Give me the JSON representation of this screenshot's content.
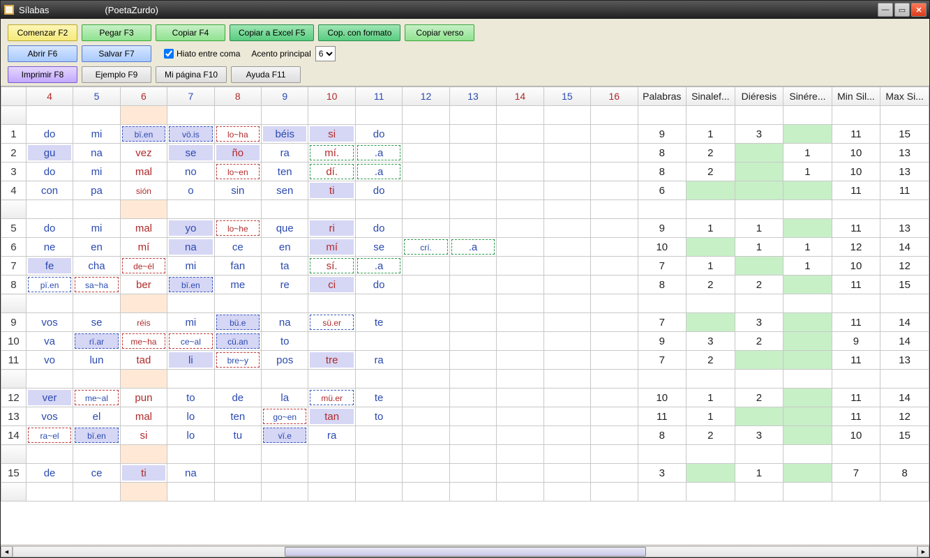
{
  "window": {
    "title": "Sílabas",
    "subtitle": "(PoetaZurdo)"
  },
  "toolbar": {
    "row1": [
      {
        "id": "comenzar",
        "label": "Comenzar F2",
        "cls": "yellow"
      },
      {
        "id": "pegar",
        "label": "Pegar F3",
        "cls": "green"
      },
      {
        "id": "copiar",
        "label": "Copiar F4",
        "cls": "green"
      },
      {
        "id": "copiar-excel",
        "label": "Copiar a Excel F5",
        "cls": "green2"
      },
      {
        "id": "cop-formato",
        "label": "Cop. con formato",
        "cls": "green2"
      },
      {
        "id": "copiar-verso",
        "label": "Copiar verso",
        "cls": "green"
      }
    ],
    "row2": [
      {
        "id": "abrir",
        "label": "Abrir F6",
        "cls": "blue"
      },
      {
        "id": "salvar",
        "label": "Salvar F7",
        "cls": "blue"
      }
    ],
    "row3": [
      {
        "id": "imprimir",
        "label": "Imprimir F8",
        "cls": "purple"
      },
      {
        "id": "ejemplo",
        "label": "Ejemplo F9",
        "cls": "grey"
      },
      {
        "id": "mipagina",
        "label": "Mi página F10",
        "cls": "grey"
      },
      {
        "id": "ayuda",
        "label": "Ayuda F11",
        "cls": "grey"
      }
    ],
    "hiato_label": "Hiato entre coma",
    "hiato_checked": true,
    "acento_label": "Acento principal",
    "acento_value": "6"
  },
  "columns_num": [
    "4",
    "5",
    "6",
    "7",
    "8",
    "9",
    "10",
    "11",
    "12",
    "13",
    "14",
    "15",
    "16"
  ],
  "columns_stat": [
    "Palabras",
    "Sinalef...",
    "Diéresis",
    "Sinére...",
    "Min Sil...",
    "Max Si..."
  ],
  "accent_col_index": 2,
  "rows": [
    {
      "n": "",
      "blank": true
    },
    {
      "n": "1",
      "cells": [
        {
          "t": "do",
          "c": "blue"
        },
        {
          "t": "mi",
          "c": "blue"
        },
        {
          "t": "bï.en",
          "c": "blue",
          "small": true,
          "dash": "blue",
          "fill": true
        },
        {
          "t": "vö.is",
          "c": "blue",
          "small": true,
          "dash": "blue",
          "fill": true
        },
        {
          "t": "lo~ha",
          "c": "red",
          "small": true,
          "dash": "red"
        },
        {
          "t": "béis",
          "c": "blue",
          "fill": true
        },
        {
          "t": "si",
          "c": "red",
          "fill": true
        },
        {
          "t": "do",
          "c": "blue"
        },
        {
          "t": ""
        },
        {
          "t": ""
        },
        {
          "t": ""
        },
        {
          "t": ""
        },
        {
          "t": ""
        }
      ],
      "stats": [
        "9",
        "1",
        "3",
        "",
        "11",
        "15"
      ]
    },
    {
      "n": "2",
      "cells": [
        {
          "t": "gu",
          "c": "blue",
          "fill": true
        },
        {
          "t": "na",
          "c": "blue"
        },
        {
          "t": "vez",
          "c": "red"
        },
        {
          "t": "se",
          "c": "blue",
          "fill": true
        },
        {
          "t": "ño",
          "c": "red",
          "fill": true
        },
        {
          "t": "ra",
          "c": "blue"
        },
        {
          "t": "mí.",
          "c": "red",
          "dash": "green"
        },
        {
          "t": ".a",
          "c": "blue",
          "dash": "green"
        },
        {
          "t": ""
        },
        {
          "t": ""
        },
        {
          "t": ""
        },
        {
          "t": ""
        },
        {
          "t": ""
        }
      ],
      "stats": [
        "8",
        "2",
        "",
        "1",
        "10",
        "13"
      ]
    },
    {
      "n": "3",
      "cells": [
        {
          "t": "do",
          "c": "blue"
        },
        {
          "t": "mi",
          "c": "blue"
        },
        {
          "t": "mal",
          "c": "red"
        },
        {
          "t": "no",
          "c": "blue"
        },
        {
          "t": "lo~en",
          "c": "red",
          "small": true,
          "dash": "red"
        },
        {
          "t": "ten",
          "c": "blue"
        },
        {
          "t": "dí.",
          "c": "red",
          "dash": "green"
        },
        {
          "t": ".a",
          "c": "blue",
          "dash": "green"
        },
        {
          "t": ""
        },
        {
          "t": ""
        },
        {
          "t": ""
        },
        {
          "t": ""
        },
        {
          "t": ""
        }
      ],
      "stats": [
        "8",
        "2",
        "",
        "1",
        "10",
        "13"
      ]
    },
    {
      "n": "4",
      "cells": [
        {
          "t": "con",
          "c": "blue"
        },
        {
          "t": "pa",
          "c": "blue"
        },
        {
          "t": "sión",
          "c": "red",
          "small": true
        },
        {
          "t": "o",
          "c": "blue"
        },
        {
          "t": "sin",
          "c": "blue"
        },
        {
          "t": "sen",
          "c": "blue"
        },
        {
          "t": "ti",
          "c": "red",
          "fill": true
        },
        {
          "t": "do",
          "c": "blue"
        },
        {
          "t": ""
        },
        {
          "t": ""
        },
        {
          "t": ""
        },
        {
          "t": ""
        },
        {
          "t": ""
        }
      ],
      "stats": [
        "6",
        "",
        "",
        "",
        "11",
        "11"
      ]
    },
    {
      "n": "",
      "blank": true
    },
    {
      "n": "5",
      "cells": [
        {
          "t": "do",
          "c": "blue"
        },
        {
          "t": "mi",
          "c": "blue"
        },
        {
          "t": "mal",
          "c": "red"
        },
        {
          "t": "yo",
          "c": "blue",
          "fill": true
        },
        {
          "t": "lo~he",
          "c": "red",
          "small": true,
          "dash": "red"
        },
        {
          "t": "que",
          "c": "blue"
        },
        {
          "t": "ri",
          "c": "red",
          "fill": true
        },
        {
          "t": "do",
          "c": "blue"
        },
        {
          "t": ""
        },
        {
          "t": ""
        },
        {
          "t": ""
        },
        {
          "t": ""
        },
        {
          "t": ""
        }
      ],
      "stats": [
        "9",
        "1",
        "1",
        "",
        "11",
        "13"
      ]
    },
    {
      "n": "6",
      "cells": [
        {
          "t": "ne",
          "c": "blue"
        },
        {
          "t": "en",
          "c": "blue"
        },
        {
          "t": "mí",
          "c": "red"
        },
        {
          "t": "na",
          "c": "blue",
          "fill": true
        },
        {
          "t": "ce",
          "c": "blue"
        },
        {
          "t": "en",
          "c": "blue"
        },
        {
          "t": "mí",
          "c": "red",
          "fill": true
        },
        {
          "t": "se",
          "c": "blue"
        },
        {
          "t": "crí.",
          "c": "blue",
          "small": true,
          "dash": "green"
        },
        {
          "t": ".a",
          "c": "blue",
          "dash": "green"
        },
        {
          "t": ""
        },
        {
          "t": ""
        },
        {
          "t": ""
        }
      ],
      "stats": [
        "10",
        "",
        "1",
        "1",
        "12",
        "14"
      ]
    },
    {
      "n": "7",
      "cells": [
        {
          "t": "fe",
          "c": "blue",
          "fill": true
        },
        {
          "t": "cha",
          "c": "blue"
        },
        {
          "t": "de~él",
          "c": "red",
          "small": true,
          "dash": "red"
        },
        {
          "t": "mi",
          "c": "blue"
        },
        {
          "t": "fan",
          "c": "blue"
        },
        {
          "t": "ta",
          "c": "blue"
        },
        {
          "t": "sí.",
          "c": "red",
          "dash": "green"
        },
        {
          "t": ".a",
          "c": "blue",
          "dash": "green"
        },
        {
          "t": ""
        },
        {
          "t": ""
        },
        {
          "t": ""
        },
        {
          "t": ""
        },
        {
          "t": ""
        }
      ],
      "stats": [
        "7",
        "1",
        "",
        "1",
        "10",
        "12"
      ]
    },
    {
      "n": "8",
      "cells": [
        {
          "t": "pï.en",
          "c": "blue",
          "small": true,
          "dash": "blue"
        },
        {
          "t": "sa~ha",
          "c": "blue",
          "small": true,
          "dash": "red"
        },
        {
          "t": "ber",
          "c": "red"
        },
        {
          "t": "bï.en",
          "c": "blue",
          "small": true,
          "dash": "blue",
          "fill": true
        },
        {
          "t": "me",
          "c": "blue"
        },
        {
          "t": "re",
          "c": "blue"
        },
        {
          "t": "ci",
          "c": "red",
          "fill": true
        },
        {
          "t": "do",
          "c": "blue"
        },
        {
          "t": ""
        },
        {
          "t": ""
        },
        {
          "t": ""
        },
        {
          "t": ""
        },
        {
          "t": ""
        }
      ],
      "stats": [
        "8",
        "2",
        "2",
        "",
        "11",
        "15"
      ]
    },
    {
      "n": "",
      "blank": true
    },
    {
      "n": "9",
      "cells": [
        {
          "t": "vos",
          "c": "blue"
        },
        {
          "t": "se",
          "c": "blue"
        },
        {
          "t": "réis",
          "c": "red",
          "small": true
        },
        {
          "t": "mi",
          "c": "blue"
        },
        {
          "t": "bü.e",
          "c": "blue",
          "small": true,
          "dash": "blue",
          "fill": true
        },
        {
          "t": "na",
          "c": "blue"
        },
        {
          "t": "sü.er",
          "c": "red",
          "small": true,
          "dash": "blue"
        },
        {
          "t": "te",
          "c": "blue"
        },
        {
          "t": ""
        },
        {
          "t": ""
        },
        {
          "t": ""
        },
        {
          "t": ""
        },
        {
          "t": ""
        }
      ],
      "stats": [
        "7",
        "",
        "3",
        "",
        "11",
        "14"
      ]
    },
    {
      "n": "10",
      "cells": [
        {
          "t": "va",
          "c": "blue"
        },
        {
          "t": "rï.ar",
          "c": "blue",
          "small": true,
          "dash": "blue",
          "fill": true
        },
        {
          "t": "me~ha",
          "c": "red",
          "small": true,
          "dash": "red"
        },
        {
          "t": "ce~al",
          "c": "blue",
          "small": true,
          "dash": "red"
        },
        {
          "t": "cü.an",
          "c": "blue",
          "small": true,
          "dash": "blue",
          "fill": true
        },
        {
          "t": "to",
          "c": "blue"
        },
        {
          "t": ""
        },
        {
          "t": ""
        },
        {
          "t": ""
        },
        {
          "t": ""
        },
        {
          "t": ""
        },
        {
          "t": ""
        },
        {
          "t": ""
        }
      ],
      "stats": [
        "9",
        "3",
        "2",
        "",
        "9",
        "14"
      ]
    },
    {
      "n": "11",
      "cells": [
        {
          "t": "vo",
          "c": "blue"
        },
        {
          "t": "lun",
          "c": "blue"
        },
        {
          "t": "tad",
          "c": "red"
        },
        {
          "t": "li",
          "c": "blue",
          "fill": true
        },
        {
          "t": "bre~y",
          "c": "blue",
          "small": true,
          "dash": "red"
        },
        {
          "t": "pos",
          "c": "blue"
        },
        {
          "t": "tre",
          "c": "red",
          "fill": true
        },
        {
          "t": "ra",
          "c": "blue"
        },
        {
          "t": ""
        },
        {
          "t": ""
        },
        {
          "t": ""
        },
        {
          "t": ""
        },
        {
          "t": ""
        }
      ],
      "stats": [
        "7",
        "2",
        "",
        "",
        "11",
        "13"
      ]
    },
    {
      "n": "",
      "blank": true
    },
    {
      "n": "12",
      "cells": [
        {
          "t": "ver",
          "c": "blue",
          "fill": true
        },
        {
          "t": "me~al",
          "c": "blue",
          "small": true,
          "dash": "red"
        },
        {
          "t": "pun",
          "c": "red"
        },
        {
          "t": "to",
          "c": "blue"
        },
        {
          "t": "de",
          "c": "blue"
        },
        {
          "t": "la",
          "c": "blue"
        },
        {
          "t": "mü.er",
          "c": "red",
          "small": true,
          "dash": "blue"
        },
        {
          "t": "te",
          "c": "blue"
        },
        {
          "t": ""
        },
        {
          "t": ""
        },
        {
          "t": ""
        },
        {
          "t": ""
        },
        {
          "t": ""
        }
      ],
      "stats": [
        "10",
        "1",
        "2",
        "",
        "11",
        "14"
      ]
    },
    {
      "n": "13",
      "cells": [
        {
          "t": "vos",
          "c": "blue"
        },
        {
          "t": "el",
          "c": "blue"
        },
        {
          "t": "mal",
          "c": "red"
        },
        {
          "t": "lo",
          "c": "blue"
        },
        {
          "t": "ten",
          "c": "blue"
        },
        {
          "t": "go~en",
          "c": "blue",
          "small": true,
          "dash": "red"
        },
        {
          "t": "tan",
          "c": "red",
          "fill": true
        },
        {
          "t": "to",
          "c": "blue"
        },
        {
          "t": ""
        },
        {
          "t": ""
        },
        {
          "t": ""
        },
        {
          "t": ""
        },
        {
          "t": ""
        }
      ],
      "stats": [
        "11",
        "1",
        "",
        "",
        "11",
        "12"
      ]
    },
    {
      "n": "14",
      "cells": [
        {
          "t": "ra~el",
          "c": "blue",
          "small": true,
          "dash": "red"
        },
        {
          "t": "bï.en",
          "c": "blue",
          "small": true,
          "dash": "blue",
          "fill": true
        },
        {
          "t": "si",
          "c": "red"
        },
        {
          "t": "lo",
          "c": "blue"
        },
        {
          "t": "tu",
          "c": "blue"
        },
        {
          "t": "vï.e",
          "c": "blue",
          "small": true,
          "dash": "blue",
          "fill": true
        },
        {
          "t": "ra",
          "c": "blue"
        },
        {
          "t": ""
        },
        {
          "t": ""
        },
        {
          "t": ""
        },
        {
          "t": ""
        },
        {
          "t": ""
        },
        {
          "t": ""
        }
      ],
      "stats": [
        "8",
        "2",
        "3",
        "",
        "10",
        "15"
      ]
    },
    {
      "n": "",
      "blank": true
    },
    {
      "n": "15",
      "cells": [
        {
          "t": "de",
          "c": "blue"
        },
        {
          "t": "ce",
          "c": "blue"
        },
        {
          "t": "ti",
          "c": "red",
          "fill": true
        },
        {
          "t": "na",
          "c": "blue"
        },
        {
          "t": ""
        },
        {
          "t": ""
        },
        {
          "t": ""
        },
        {
          "t": ""
        },
        {
          "t": ""
        },
        {
          "t": ""
        },
        {
          "t": ""
        },
        {
          "t": ""
        },
        {
          "t": ""
        }
      ],
      "stats": [
        "3",
        "",
        "1",
        "",
        "7",
        "8"
      ]
    },
    {
      "n": "",
      "blank": true
    }
  ]
}
